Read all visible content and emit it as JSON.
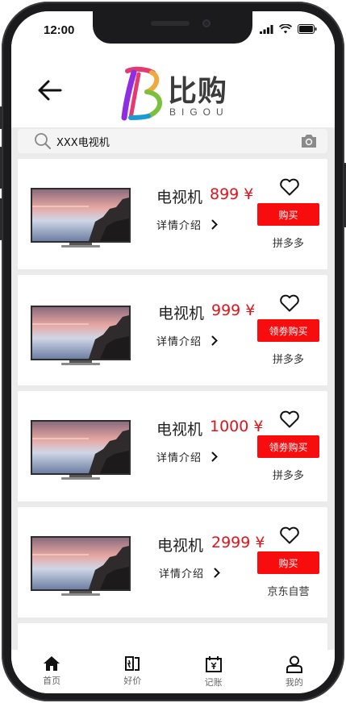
{
  "status_bar": {
    "time": "12:00"
  },
  "header": {
    "back_icon": "arrow-left-icon",
    "logo_title": "比购",
    "logo_subtitle": "BIGOU",
    "logo_colors": [
      "#8e2de2",
      "#e53a6f",
      "#f2a93b",
      "#7cc13e",
      "#1c9ad6"
    ]
  },
  "search": {
    "value": "XXX电视机",
    "placeholder": "XXX电视机",
    "icon": "search-icon",
    "camera_icon": "camera-icon"
  },
  "products": [
    {
      "name": "电视机",
      "price": "899 ¥",
      "detail": "详情介绍",
      "buy_label": "购买",
      "store": "拼多多"
    },
    {
      "name": "电视机",
      "price": "999 ¥",
      "detail": "详情介绍",
      "buy_label": "领劵购买",
      "store": "拼多多"
    },
    {
      "name": "电视机",
      "price": "1000 ¥",
      "detail": "详情介绍",
      "buy_label": "领劵购买",
      "store": "拼多多"
    },
    {
      "name": "电视机",
      "price": "2999 ¥",
      "detail": "详情介绍",
      "buy_label": "购买",
      "store": "京东自营"
    }
  ],
  "tabbar": {
    "items": [
      {
        "label": "首页",
        "icon": "home-icon"
      },
      {
        "label": "好价",
        "icon": "price-tag-icon"
      },
      {
        "label": "记账",
        "icon": "calendar-yen-icon"
      },
      {
        "label": "我的",
        "icon": "user-icon"
      }
    ]
  },
  "colors": {
    "accent": "#f70d0d",
    "price": "#e0141b",
    "background": "#ebebeb"
  }
}
